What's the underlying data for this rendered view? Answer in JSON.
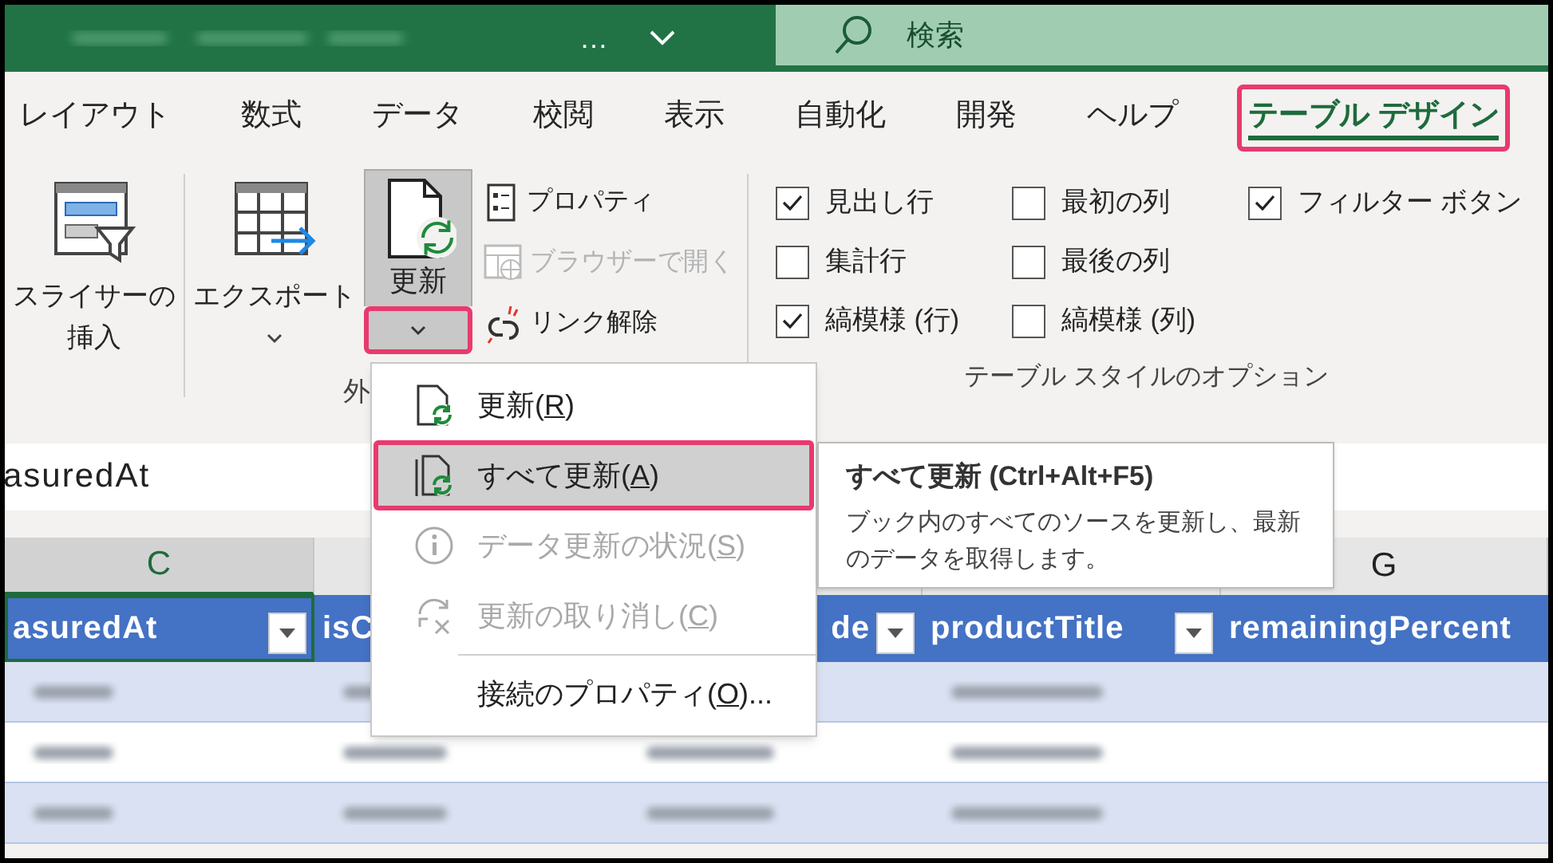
{
  "title_bar": {
    "more": "…",
    "search": {
      "placeholder": "検索"
    }
  },
  "tabs": [
    {
      "label": "レイアウト",
      "selected": false,
      "highlighted": false
    },
    {
      "label": "数式",
      "selected": false,
      "highlighted": false
    },
    {
      "label": "データ",
      "selected": false,
      "highlighted": false
    },
    {
      "label": "校閲",
      "selected": false,
      "highlighted": false
    },
    {
      "label": "表示",
      "selected": false,
      "highlighted": false
    },
    {
      "label": "自動化",
      "selected": false,
      "highlighted": false
    },
    {
      "label": "開発",
      "selected": false,
      "highlighted": false
    },
    {
      "label": "ヘルプ",
      "selected": false,
      "highlighted": false
    },
    {
      "label": "テーブル デザイン",
      "selected": true,
      "highlighted": true
    }
  ],
  "ribbon": {
    "slicer_button": {
      "lines": [
        "スライサーの",
        "挿入"
      ]
    },
    "export_button": {
      "label": "エクスポート"
    },
    "refresh_button": {
      "label": "更新",
      "pressed": true,
      "arrow_highlighted": true
    },
    "small_buttons": [
      {
        "kind": "properties",
        "label": "プロパティ",
        "disabled": false
      },
      {
        "kind": "browser",
        "label": "ブラウザーで開く",
        "disabled": true
      },
      {
        "kind": "unlink",
        "label": "リンク解除",
        "disabled": false
      }
    ],
    "external_group_label": "外",
    "style_options": {
      "columns": [
        [
          {
            "label": "見出し行",
            "checked": true
          },
          {
            "label": "集計行",
            "checked": false
          },
          {
            "label": "縞模様 (行)",
            "checked": true
          }
        ],
        [
          {
            "label": "最初の列",
            "checked": false
          },
          {
            "label": "最後の列",
            "checked": false
          },
          {
            "label": "縞模様 (列)",
            "checked": false
          }
        ],
        [
          {
            "label": "フィルター ボタン",
            "checked": true
          }
        ]
      ],
      "group_label": "テーブル スタイルのオプション"
    }
  },
  "formula_bar": {
    "value": "asuredAt"
  },
  "column_headers": [
    {
      "letter": "C"
    },
    {
      "letter": "G"
    }
  ],
  "table_header": [
    {
      "text": "asuredAt",
      "filter": true,
      "selected": true
    },
    {
      "text": "isC",
      "filter": false,
      "selected": false
    },
    {
      "text": "de",
      "filter": true,
      "selected": false
    },
    {
      "text": "productTitle",
      "filter": true,
      "selected": false
    },
    {
      "text": "remainingPercent",
      "filter": false,
      "selected": false
    }
  ],
  "refresh_menu": {
    "items": [
      {
        "kind": "refresh",
        "before": "更新(",
        "key": "R",
        "after": ")",
        "disabled": false,
        "hovered": false,
        "highlighted": false,
        "separator_before": false
      },
      {
        "kind": "refresh_all",
        "before": "すべて更新(",
        "key": "A",
        "after": ")",
        "disabled": false,
        "hovered": true,
        "highlighted": true,
        "separator_before": false
      },
      {
        "kind": "status",
        "before": "データ更新の状況(",
        "key": "S",
        "after": ")",
        "disabled": true,
        "hovered": false,
        "highlighted": false,
        "separator_before": false
      },
      {
        "kind": "cancel",
        "before": "更新の取り消し(",
        "key": "C",
        "after": ")",
        "disabled": true,
        "hovered": false,
        "highlighted": false,
        "separator_before": false
      },
      {
        "kind": "connection",
        "before": "接続のプロパティ(",
        "key": "O",
        "after": ")...",
        "disabled": false,
        "hovered": false,
        "highlighted": false,
        "separator_before": true
      }
    ]
  },
  "tooltip": {
    "title": "すべて更新 (Ctrl+Alt+F5)",
    "text": "ブック内のすべてのソースを更新し、最新のデータを取得します。"
  }
}
